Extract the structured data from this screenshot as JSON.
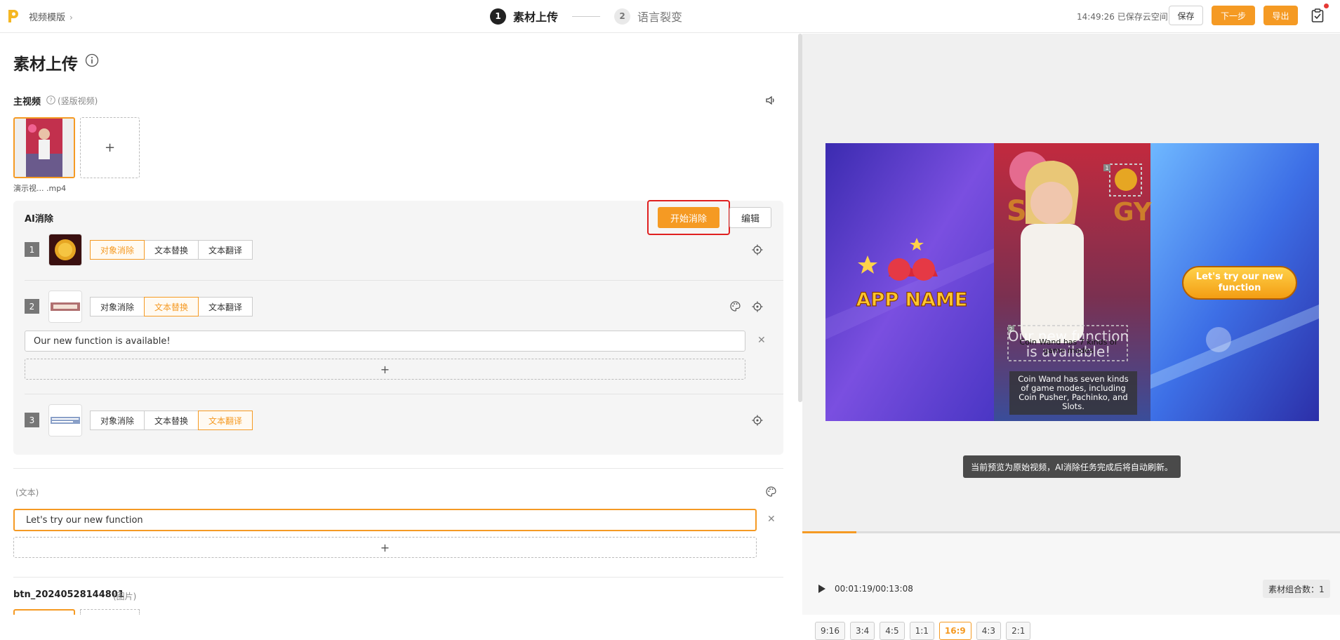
{
  "header": {
    "breadcrumb": "视频模版",
    "steps": [
      {
        "num": "1",
        "label": "素材上传"
      },
      {
        "num": "2",
        "label": "语言裂变"
      }
    ],
    "status": "14:49:26 已保存云空间",
    "save_label": "保存",
    "next_label": "下一步",
    "export_label": "导出",
    "colors": {
      "accent": "#f59a23",
      "notify": "#e53935"
    }
  },
  "left": {
    "title": "素材上传",
    "main_video": {
      "label": "主视频",
      "sub": "(竖版视频)",
      "file_name": "演示视...  .mp4",
      "add": "+"
    },
    "ai": {
      "title": "AI消除",
      "start_label": "开始消除",
      "edit_label": "编辑",
      "rows": [
        {
          "num": "1",
          "options": [
            "对象消除",
            "文本替换",
            "文本翻译"
          ],
          "selected": 0
        },
        {
          "num": "2",
          "options": [
            "对象消除",
            "文本替换",
            "文本翻译"
          ],
          "selected": 1,
          "text": "Our new function is available!",
          "add": "+"
        },
        {
          "num": "3",
          "options": [
            "对象消除",
            "文本替换",
            "文本翻译"
          ],
          "selected": 2
        }
      ]
    },
    "text_section": {
      "label": "(文本)",
      "value": "Let's try our new function",
      "add": "+"
    },
    "btn_section": {
      "label": "btn_20240528144801",
      "sub": "(图片)"
    }
  },
  "preview": {
    "app_name": "APP NAME",
    "cta": "Let's try our new function",
    "overlay_top": "Our new function is available!",
    "overlay_mid": "Coin Wand has 7 kinds of game modes",
    "caption": "Coin Wand has seven kinds of game modes, including Coin Pusher, Pachinko, and Slots.",
    "mark1": "1",
    "mark2": "2",
    "toast": "当前预览为原始视频，AI消除任务完成后将自动刷新。",
    "timecode": "00:01:19/00:13:08",
    "progress": 0.1,
    "combo": "素材组合数：1",
    "ratios": [
      "9:16",
      "3:4",
      "4:5",
      "1:1",
      "16:9",
      "4:3",
      "2:1"
    ],
    "selected_ratio": "16:9"
  }
}
